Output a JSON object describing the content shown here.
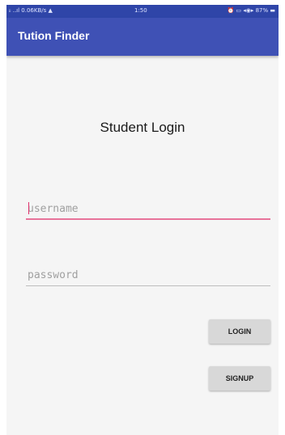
{
  "status_bar": {
    "left": "ᵢᵢ ..ıl 0.06KB/s ▲",
    "time": "1:50",
    "right": "⏰ ▭ ◂◉▸ 87% ▬"
  },
  "app_bar": {
    "title": "Tution Finder"
  },
  "login": {
    "heading": "Student Login",
    "username_placeholder": "username",
    "password_placeholder": "password",
    "login_label": "LOGIN",
    "signup_label": "SIGNUP"
  },
  "colors": {
    "app_bar": "#3f51b5",
    "status_bar": "#2f45a8",
    "focused_underline": "#e8739a"
  }
}
